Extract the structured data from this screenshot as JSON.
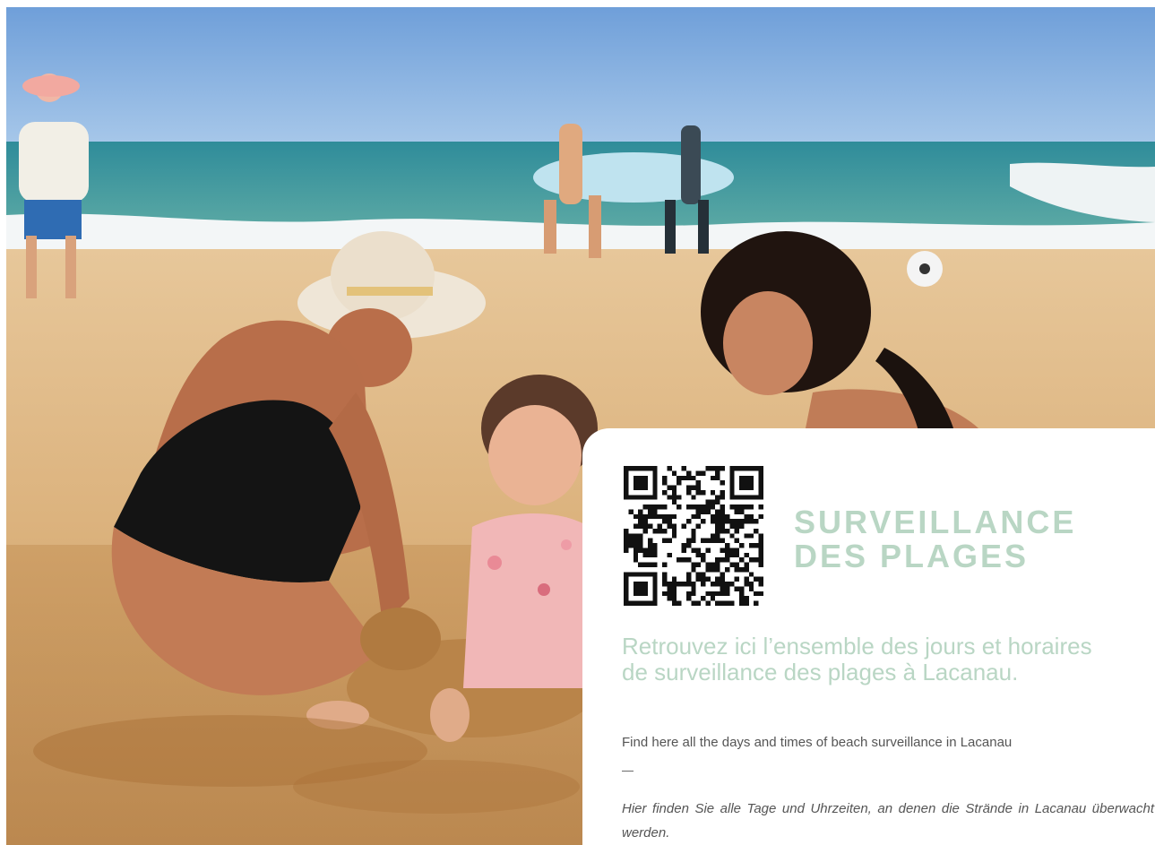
{
  "hero": {
    "image": "beach-family-sand-photo"
  },
  "card": {
    "qr_icon": "qr-code-icon",
    "title_line1": "SURVEILLANCE",
    "title_line2": "DES PLAGES",
    "lead_fr": "Retrouvez ici l’ensemble des jours et horaires de surveillance des plages à Lacanau.",
    "lead_en": "Find here all the days and times of beach surveillance in Lacanau",
    "separator": "—",
    "lead_de": "Hier finden Sie alle Tage und Uhrzeiten, an denen die Strände in Lacanau überwacht werden."
  },
  "colors": {
    "accent": "#b9d6c4",
    "body_text": "#555555",
    "card_bg": "#ffffff"
  }
}
